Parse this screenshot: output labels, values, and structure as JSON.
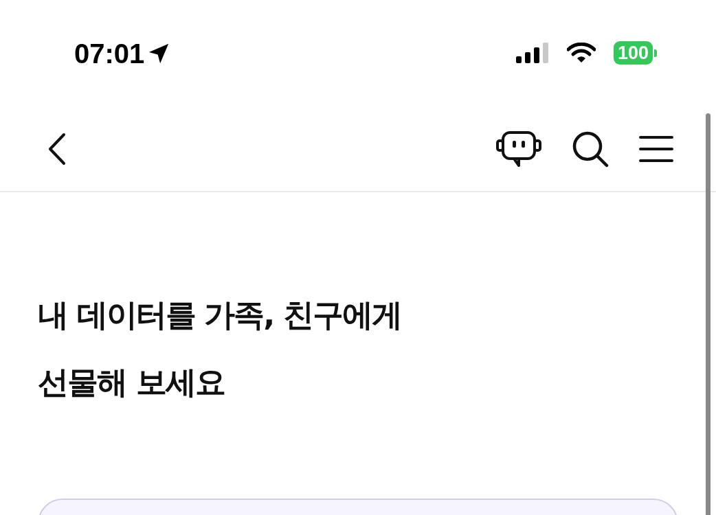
{
  "status_bar": {
    "time": "07:01",
    "battery": "100"
  },
  "title": {
    "lines": [
      "내 데이터를 가족, 친구에게",
      "선물해 보세요"
    ]
  }
}
